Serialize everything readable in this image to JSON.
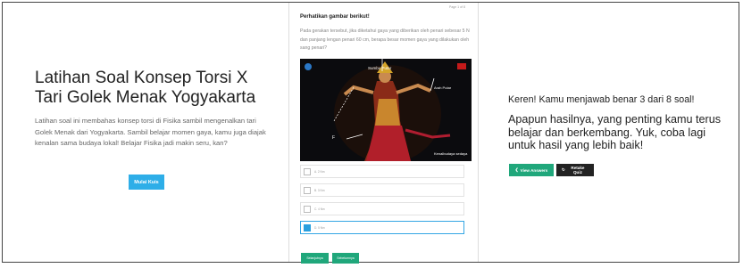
{
  "intro": {
    "title": "Latihan Soal Konsep Torsi X Tari Golek Menak Yogyakarta",
    "description": "Latihan soal ini membahas konsep torsi di Fisika sambil mengenalkan tari Golek Menak dari Yogyakarta. Sambil belajar momen gaya, kamu juga diajak kenalan sama budaya lokal! Belajar Fisika jadi makin seru, kan?",
    "start_button": "Mulai Kuis"
  },
  "question": {
    "page_indicator": "Page 1 of 8",
    "heading": "Perhatikan gambar berikut!",
    "text": "Pada gerakan tersebut, jika diketahui gaya yang diberikan oleh penari sebesar 5 N dan panjang lengan penari 60 cm, berapa besar momen gaya yang dilakukan oleh sang penari?",
    "image_labels": {
      "axis": "Sumbu Putar",
      "arm": "Arah Putar",
      "force": "F",
      "credit": "Kenalbudaya sedaya"
    },
    "options": [
      {
        "label": "A. 2 Nm",
        "selected": false
      },
      {
        "label": "B. 3 Nm",
        "selected": false
      },
      {
        "label": "C. 4 Nm",
        "selected": false
      },
      {
        "label": "D. 5 Nm",
        "selected": true
      }
    ],
    "submit_button": "Selanjutnya",
    "next_button": "Sebelumnya"
  },
  "result": {
    "score_text": "Keren! Kamu menjawab benar 3 dari 8 soal!",
    "message": "Apapun hasilnya, yang penting kamu terus belajar dan berkembang. Yuk, coba lagi untuk hasil yang lebih baik!",
    "view_answers": "View Answers",
    "retake": "Retake Quiz"
  },
  "colors": {
    "start_button": "#2eaee8",
    "green_button": "#20a77b",
    "dark_button": "#222222",
    "selected_option": "#2a9fde"
  }
}
